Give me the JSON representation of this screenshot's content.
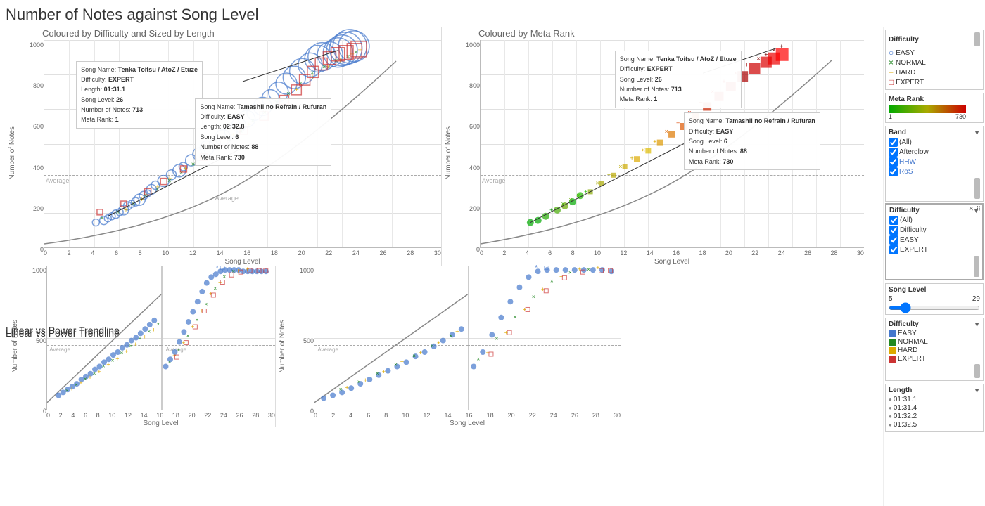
{
  "page": {
    "title": "Number of Notes against Song Level"
  },
  "charts": {
    "top_left": {
      "title": "Coloured by Difficulty and Sized by Length",
      "x_axis": "Song Level",
      "y_axis": "Number of Notes",
      "x_labels": [
        "0",
        "2",
        "4",
        "6",
        "8",
        "10",
        "12",
        "14",
        "16",
        "18",
        "20",
        "22",
        "24",
        "26",
        "28",
        "30"
      ],
      "y_labels": [
        "1000",
        "800",
        "600",
        "400",
        "200",
        "0"
      ],
      "tooltip": {
        "song_name_label": "Song Name:",
        "song_name_value": "Tenka Toitsu / AtoZ / Etuze",
        "difficulty_label": "Difficulty:",
        "difficulty_value": "EXPERT",
        "length_label": "Length:",
        "length_value": "01:31.1",
        "song_level_label": "Song Level:",
        "song_level_value": "26",
        "notes_label": "Number of Notes:",
        "notes_value": "713",
        "meta_rank_label": "Meta Rank:",
        "meta_rank_value": "1"
      },
      "tooltip2": {
        "song_name_label": "Song Name:",
        "song_name_value": "Tamashii no Refrain / Rufuran",
        "difficulty_label": "Difficulty:",
        "difficulty_value": "EASY",
        "length_label": "Length:",
        "length_value": "02:32.8",
        "song_level_label": "Song Level:",
        "song_level_value": "6",
        "notes_label": "Number of Notes:",
        "notes_value": "88",
        "meta_rank_label": "Meta Rank:",
        "meta_rank_value": "730"
      },
      "avg_label": "Average"
    },
    "top_right": {
      "title": "Coloured by Meta Rank",
      "x_axis": "Song Level",
      "y_axis": "Number of Notes",
      "x_labels": [
        "0",
        "2",
        "4",
        "6",
        "8",
        "10",
        "12",
        "14",
        "16",
        "18",
        "20",
        "22",
        "24",
        "26",
        "28",
        "30"
      ],
      "y_labels": [
        "1000",
        "800",
        "600",
        "400",
        "200",
        "0"
      ],
      "tooltip": {
        "song_name_label": "Song Name:",
        "song_name_value": "Tenka Toitsu / AtoZ / Etuze",
        "difficulty_label": "Difficulty:",
        "difficulty_value": "EXPERT",
        "song_level_label": "Song Level:",
        "song_level_value": "26",
        "notes_label": "Number of Notes:",
        "notes_value": "713",
        "meta_rank_label": "Meta Rank:",
        "meta_rank_value": "1"
      },
      "tooltip2": {
        "song_name_label": "Song Name:",
        "song_name_value": "Tamashii no Refrain / Rufuran",
        "difficulty_label": "Difficulty:",
        "difficulty_value": "EASY",
        "song_level_label": "Song Level:",
        "song_level_value": "6",
        "notes_label": "Number of Notes:",
        "notes_value": "88",
        "meta_rank_label": "Meta Rank:",
        "meta_rank_value": "730"
      },
      "avg_label": "Average"
    },
    "bottom": {
      "title": "Linear vs Power Trendline",
      "x_axis": "Song Level",
      "y_axis": "Number of Notes",
      "x_labels_left": [
        "0",
        "2",
        "4",
        "6",
        "8",
        "10",
        "12",
        "14",
        "16"
      ],
      "x_labels_right": [
        "16",
        "18",
        "20",
        "22",
        "24",
        "26",
        "28",
        "30"
      ],
      "y_labels": [
        "1000",
        "500",
        "0"
      ],
      "avg_label": "Average"
    }
  },
  "sidebar": {
    "difficulty_legend": {
      "title": "Difficulty",
      "items": [
        {
          "symbol": "○",
          "label": "EASY",
          "color": "#4477cc"
        },
        {
          "symbol": "×",
          "label": "NORMAL",
          "color": "#228822"
        },
        {
          "symbol": "+",
          "label": "HARD",
          "color": "#ddaa00"
        },
        {
          "symbol": "□",
          "label": "EXPERT",
          "color": "#cc3333"
        }
      ]
    },
    "meta_rank_legend": {
      "title": "Meta Rank",
      "min": "1",
      "max": "730"
    },
    "band_filter": {
      "title": "Band",
      "items": [
        {
          "label": "(All)",
          "checked": true
        },
        {
          "label": "Afterglow",
          "checked": true
        },
        {
          "label": "HHW",
          "checked": true
        },
        {
          "label": "RoS",
          "checked": true
        }
      ]
    },
    "difficulty_filter": {
      "title": "Difficulty",
      "items": [
        {
          "label": "(All)",
          "checked": true
        },
        {
          "label": "Difficulty",
          "checked": true
        },
        {
          "label": "EASY",
          "checked": true
        },
        {
          "label": "EXPERT",
          "checked": true
        }
      ]
    },
    "song_level_filter": {
      "title": "Song Level",
      "min": "5",
      "max": "29"
    },
    "difficulty_legend2": {
      "title": "Difficulty",
      "items": [
        {
          "symbol": "■",
          "label": "EASY",
          "color": "#4477cc"
        },
        {
          "symbol": "■",
          "label": "NORMAL",
          "color": "#228822"
        },
        {
          "symbol": "■",
          "label": "HARD",
          "color": "#ddaa00"
        },
        {
          "symbol": "■",
          "label": "EXPERT",
          "color": "#cc3333"
        }
      ]
    },
    "length_filter": {
      "title": "Length",
      "items": [
        {
          "label": "01:31.1"
        },
        {
          "label": "01:31.4"
        },
        {
          "label": "01:32.2"
        },
        {
          "label": "01:32.5"
        }
      ]
    }
  }
}
